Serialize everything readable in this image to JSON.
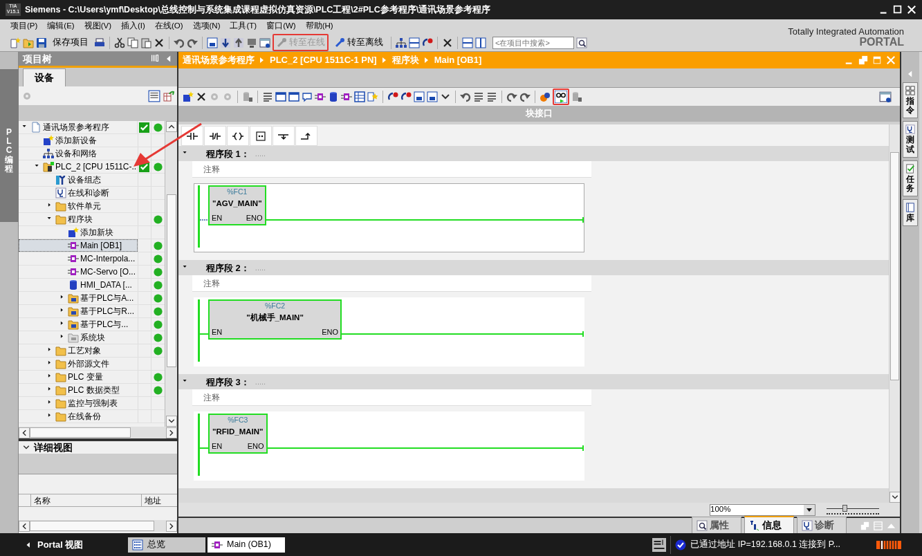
{
  "window": {
    "logo": "TIA",
    "logo_version": "V15.1",
    "title": "Siemens  -  C:\\Users\\ymf\\Desktop\\总线控制与系统集成课程虚拟仿真资源\\PLC工程\\2#PLC参考程序\\通讯场景参考程序"
  },
  "menu": [
    "项目(P)",
    "编辑(E)",
    "视图(V)",
    "插入(I)",
    "在线(O)",
    "选项(N)",
    "工具(T)",
    "窗口(W)",
    "帮助(H)"
  ],
  "toolbar": [
    {
      "label": "保存项目",
      "disabled": false,
      "highlighted": false
    },
    {
      "label": "转至在线",
      "disabled": true,
      "highlighted": true
    },
    {
      "label": "转至离线",
      "disabled": false,
      "highlighted": false
    }
  ],
  "search": {
    "placeholder": "<在项目中搜索>"
  },
  "brand": {
    "line1": "Totally Integrated Automation",
    "line2": "PORTAL"
  },
  "side_tab": "PLC 编程",
  "annotation_arrow": true,
  "project_tree": {
    "title": "项目树",
    "tab": "设备",
    "items": [
      {
        "label": "通讯场景参考程序",
        "kind": "project",
        "expanded": true,
        "checked": true,
        "online": true,
        "selected": false,
        "children": [
          {
            "label": "添加新设备",
            "kind": "add",
            "checked": false,
            "online": false,
            "selected": false
          },
          {
            "label": "设备和网络",
            "kind": "network",
            "checked": false,
            "online": false,
            "selected": false
          },
          {
            "label": "PLC_2 [CPU 1511C-...",
            "kind": "device",
            "expanded": true,
            "checked": true,
            "online": true,
            "selected": false,
            "children": [
              {
                "label": "设备组态",
                "kind": "config",
                "checked": false,
                "online": false,
                "selected": false
              },
              {
                "label": "在线和诊断",
                "kind": "diagnostics",
                "checked": false,
                "online": false,
                "selected": false
              },
              {
                "label": "软件单元",
                "kind": "folder",
                "expanded": false,
                "checked": false,
                "online": false,
                "selected": false
              },
              {
                "label": "程序块",
                "kind": "folder",
                "expanded": true,
                "checked": false,
                "online": true,
                "selected": false,
                "children": [
                  {
                    "label": "添加新块",
                    "kind": "add",
                    "checked": false,
                    "online": false,
                    "selected": false
                  },
                  {
                    "label": "Main [OB1]",
                    "kind": "block",
                    "checked": false,
                    "online": true,
                    "selected": true
                  },
                  {
                    "label": "MC-Interpola...",
                    "kind": "block",
                    "checked": false,
                    "online": true,
                    "selected": false
                  },
                  {
                    "label": "MC-Servo [O...",
                    "kind": "block",
                    "checked": false,
                    "online": true,
                    "selected": false
                  },
                  {
                    "label": "HMI_DATA [...",
                    "kind": "db",
                    "checked": false,
                    "online": true,
                    "selected": false
                  },
                  {
                    "label": "基于PLC与A...",
                    "kind": "group",
                    "expanded": false,
                    "checked": false,
                    "online": true,
                    "selected": false
                  },
                  {
                    "label": "基于PLC与R...",
                    "kind": "group",
                    "expanded": false,
                    "checked": false,
                    "online": true,
                    "selected": false
                  },
                  {
                    "label": "基于PLC与...",
                    "kind": "group",
                    "expanded": false,
                    "checked": false,
                    "online": true,
                    "selected": false
                  },
                  {
                    "label": "系统块",
                    "kind": "sysfolder",
                    "expanded": false,
                    "checked": false,
                    "online": true,
                    "selected": false
                  }
                ]
              },
              {
                "label": "工艺对象",
                "kind": "folder",
                "expanded": false,
                "checked": false,
                "online": true,
                "selected": false
              },
              {
                "label": "外部源文件",
                "kind": "folder",
                "expanded": false,
                "checked": false,
                "online": false,
                "selected": false
              },
              {
                "label": "PLC 变量",
                "kind": "folder",
                "expanded": false,
                "checked": false,
                "online": true,
                "selected": false
              },
              {
                "label": "PLC 数据类型",
                "kind": "folder",
                "expanded": false,
                "checked": false,
                "online": true,
                "selected": false
              },
              {
                "label": "监控与强制表",
                "kind": "folder",
                "expanded": false,
                "checked": false,
                "online": false,
                "selected": false
              },
              {
                "label": "在线备份",
                "kind": "folder",
                "expanded": false,
                "checked": false,
                "online": false,
                "selected": false
              }
            ]
          }
        ]
      }
    ],
    "details": {
      "title": "详细视图",
      "columns": [
        "名称",
        "地址"
      ]
    }
  },
  "editor": {
    "breadcrumb": [
      "通讯场景参考程序",
      "PLC_2 [CPU 1511C-1 PN]",
      "程序块",
      "Main [OB1]"
    ],
    "monitor_highlighted": true,
    "interface_label": "块接口",
    "networks": [
      {
        "title": "程序段 1：",
        "dots": ".....",
        "comment": "注释",
        "address": "%FC1",
        "name": "\"AGV_MAIN\"",
        "en": "EN",
        "eno": "ENO",
        "selected": true,
        "wide": false
      },
      {
        "title": "程序段 2：",
        "dots": ".....",
        "comment": "注释",
        "address": "%FC2",
        "name": "\"机械手_MAIN\"",
        "en": "EN",
        "eno": "ENO",
        "selected": false,
        "wide": true
      },
      {
        "title": "程序段 3：",
        "dots": ".....",
        "comment": "注释",
        "address": "%FC3",
        "name": "\"RFID_MAIN\"",
        "en": "EN",
        "eno": "ENO",
        "selected": false,
        "wide": false
      }
    ],
    "zoom": "100%",
    "zoom_slider": {
      "level": 0.35
    }
  },
  "right_tabs": [
    "指令",
    "测试",
    "任务",
    "库"
  ],
  "inspector_tabs": [
    {
      "label": "属性",
      "selected": false
    },
    {
      "label": "信息",
      "selected": true
    },
    {
      "label": "诊断",
      "selected": false
    }
  ],
  "status_bar": {
    "portal": "Portal 视图",
    "tabs": [
      {
        "label": "总览",
        "selected": false
      },
      {
        "label": "Main (OB1)",
        "selected": true
      }
    ],
    "message": "已通过地址 IP=192.168.0.1 连接到 P..."
  }
}
